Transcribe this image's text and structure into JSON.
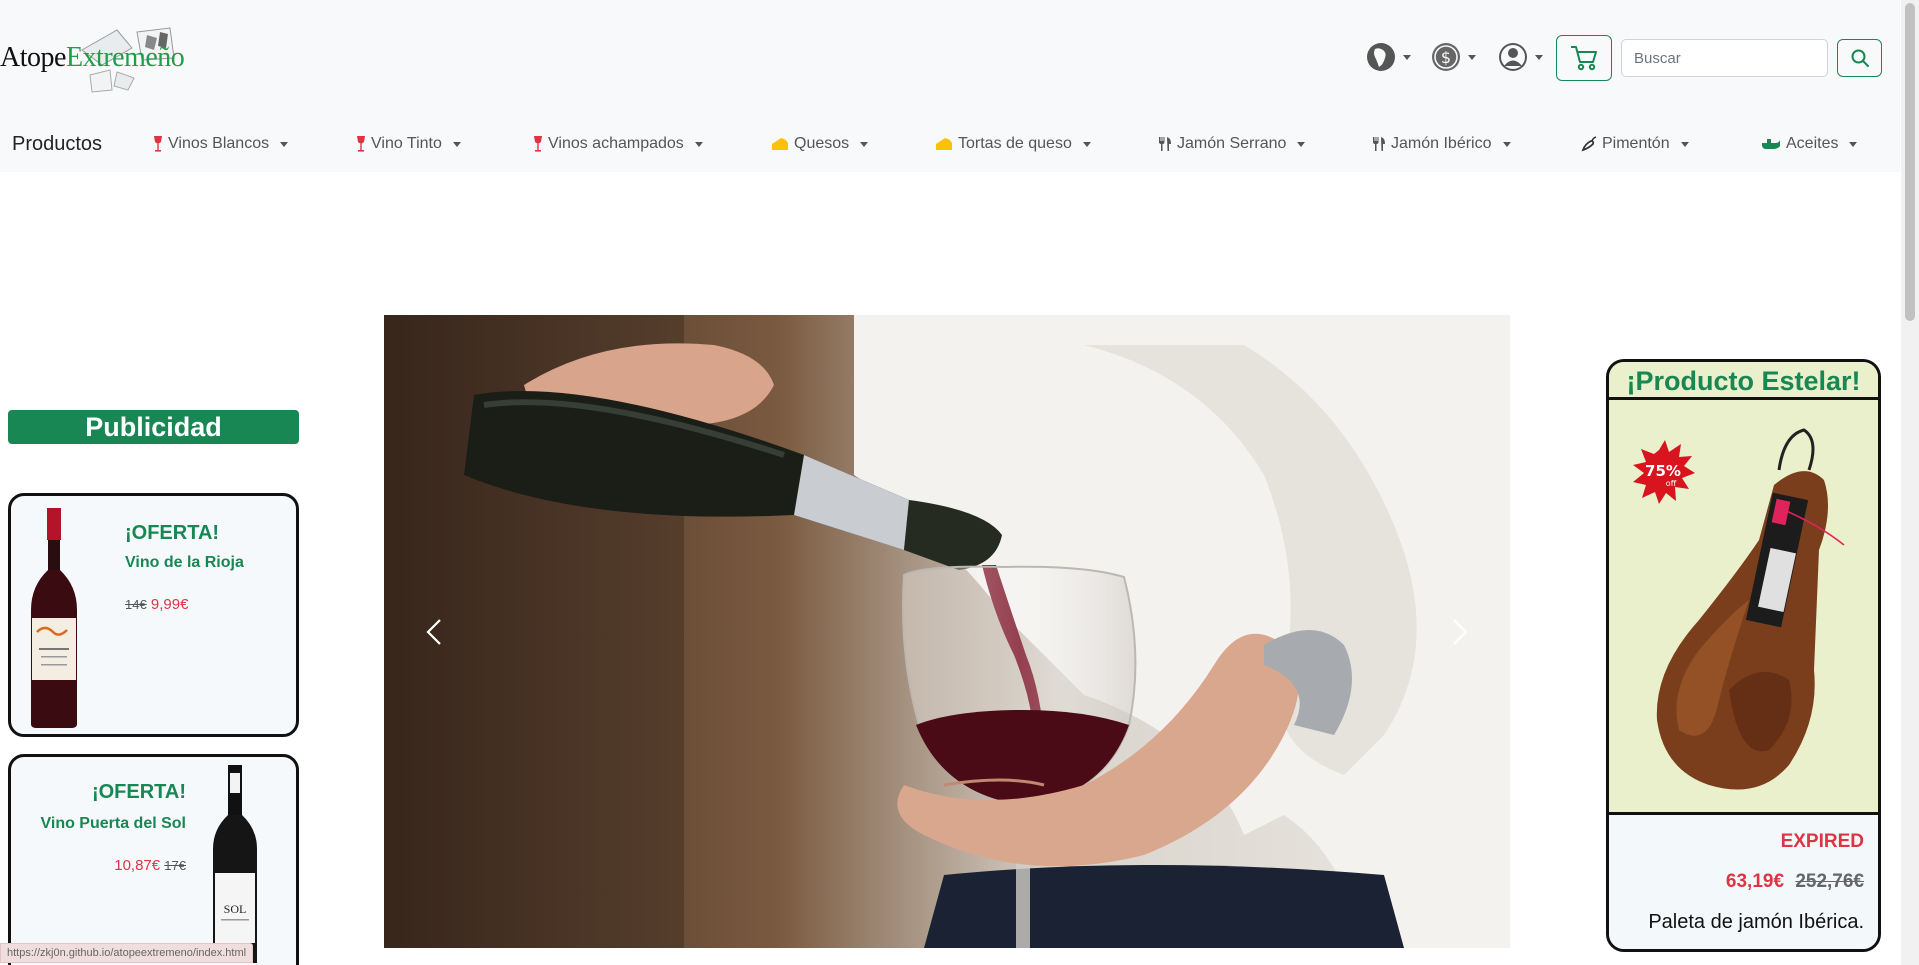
{
  "header": {
    "logo": {
      "part1": "Atope",
      "part2": "Extremeño"
    },
    "search": {
      "placeholder": "Buscar"
    }
  },
  "nav": {
    "brand": "Productos",
    "items": [
      {
        "label": "Vinos Blancos",
        "icon": "wine-glass-icon"
      },
      {
        "label": "Vino Tinto",
        "icon": "wine-glass-icon"
      },
      {
        "label": "Vinos achampados",
        "icon": "wine-glass-icon"
      },
      {
        "label": "Quesos",
        "icon": "cheese-icon"
      },
      {
        "label": "Tortas de queso",
        "icon": "cheese-icon"
      },
      {
        "label": "Jamón Serrano",
        "icon": "utensils-icon"
      },
      {
        "label": "Jamón Ibérico",
        "icon": "utensils-icon"
      },
      {
        "label": "Pimentón",
        "icon": "pepper-icon"
      },
      {
        "label": "Aceites",
        "icon": "oil-lamp-icon"
      }
    ]
  },
  "sidebar": {
    "title": "Publicidad",
    "ads": [
      {
        "offer": "¡OFERTA!",
        "name": "Vino de la Rioja",
        "old_price": "14€",
        "price": "9,99€"
      },
      {
        "offer": "¡OFERTA!",
        "name": "Vino Puerta del Sol",
        "old_price": "17€",
        "price": "10,87€"
      }
    ]
  },
  "featured": {
    "title": "¡Producto Estelar!",
    "badge": "75% off",
    "status": "EXPIRED",
    "price": "63,19€",
    "old_price": "252,76€",
    "name": "Paleta de jamón Ibérica."
  },
  "status_bar": {
    "url": "https://zkj0n.github.io/atopeextremeno/index.html"
  }
}
